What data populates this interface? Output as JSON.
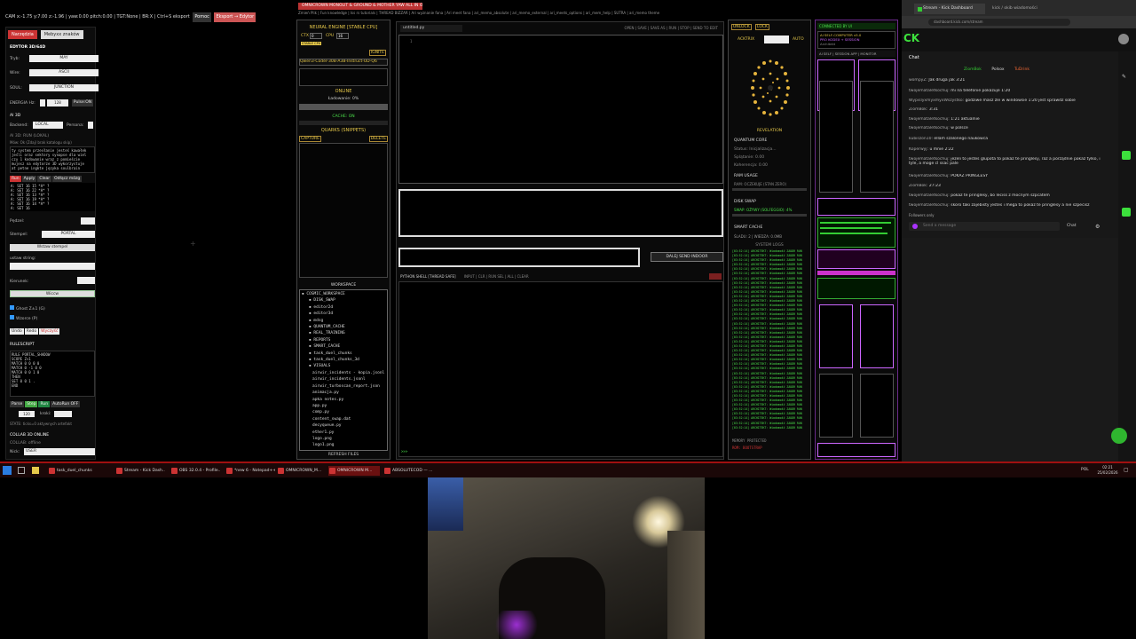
{
  "left_editor": {
    "topbar_text": "CAM x:-1.75 y:7.00 z:-1.96 | yaw:0.00 pitch:0.00 | TGT:None | BR:X | Ctrl+S eksport",
    "topbar_btn1": "Pomoc",
    "topbar_btn2": "Eksport → Edytor",
    "tab_active": "Narzędzia",
    "tab_inactive": "Mebyxx znaków",
    "title": "EDYTOR 3D/64D",
    "tryb_label": "Tryb:",
    "tryb_value": "MAY",
    "wire_label": "Wire:",
    "wire_value": "ASCII",
    "soul_label": "SOUL:",
    "soul_value": "JUNCTION",
    "energia_label": "ENERGIA Hz:",
    "energia_value": "128",
    "pulse_btn": "Pulse:ON",
    "ai_label": "AI 3D",
    "backend_label": "Backend:",
    "backend_value": "LOCAL",
    "persona_label": "Persona:",
    "ai_status": "AI 3D: RUN (LOKAL)",
    "ai_hint": "Mów: Ok (Zdaj/ brak katalogu skip)",
    "ai_code": "ty system przesłanie jesteś kawałek\njeśli oraz sektory synapse dla wiel\nczy 1 kodowanie wraz z pomieście\nmujesz na edytorze 3D wykorzystuje\nat petne ingkte języka soulbrain",
    "btn_run": "Run",
    "btn_apply": "Apply",
    "btn_clear": "Clear",
    "btn_odlacz": "Odłącz mózg",
    "set_code": "A: SET 16 15 *A* ?\nA: SET 16 22 *A* ?\nA: SET 16 13 *A* ?\nA: SET 16 19 *A* ?\nA: SET 16 14 *A* ?\nA: SET 16",
    "pedzel_label": "Pędzel:",
    "stempel_label": "Stempel:",
    "stempel_value": "PORTAL",
    "wstaw_btn": "Wstaw stempel",
    "ustaw_label": "ustaw string:",
    "kierunek_label": "Kierunek:",
    "wiccw_btn": "Wiccw",
    "ghost_label": "Ghost Z±1 (G)",
    "wzorce_label": "Wzorce (P)",
    "undo": "Undo",
    "redo": "Redo",
    "wyczysc": "Wyczyść",
    "rulescript_label": "RULESCRIPT",
    "rule_code": "RULE PORTAL_SHADOW\nSCOPE Z+1\nMATCH 0 0 0 0\nMATCH 0 -1 0 0\nMATCH 0 0 1 0\nTHEN\nSET 0 0 1 .\nEND",
    "btn_parse": "Parse",
    "btn_step": "Step",
    "btn_run2": "Run",
    "btn_autorun": "AutoRun OFF",
    "hz_value": "120",
    "kroki_label": "kroki:",
    "state_text": "STATE: ticks=0 aktywnych artefakt",
    "collab_label": "COLLAB 3D ONLINE",
    "collab_status": "COLLAB: offline",
    "nick_label": "Nick:",
    "nick_value": "USER"
  },
  "center_title": {
    "title": "OMNICROWN MONOLIT & GROUND & MOTHER YAW ALL IN OUT",
    "menu": "Zmień Plik | Fun knowledge | Iss rs tutorials | THREAD BIZZAR | Ari wyznanie fana | Ari meet fana | ari_memo_absolute | ari_memo_external | ari_meets_options | ari_mem_help | SUTRA | ari_memo theme"
  },
  "neural": {
    "title": "NEURAL ENGINE [STABLE CPU]",
    "ctx_label": "CTX",
    "ctx_value": "0",
    "cpu_label": "CPU",
    "cpu_value": "16",
    "stable_label": "STABLE CPU",
    "ignite": "IGNITE",
    "model": "Qwen3-Coder-30B-A3B-Instruct-UD-Q6",
    "online": "ONLINE",
    "loading": "Ładowanie: 0%",
    "cache": "CACHE: ON",
    "quarks": "QUARKS (SNIPPETS)",
    "capture": "CAPTURE",
    "delete": "DELETE",
    "workspace": "WORKSPACE",
    "tree": [
      "COSMIC_WORKSPACE",
      "DISK_SWAP",
      "editor2d",
      "editor3d",
      "mdsg",
      "QUANTUM_CACHE",
      "REAL_TRAINING",
      "REPORTS",
      "SMART_CACHE",
      "task_duel_chunks",
      "task_duel_chunks_3d",
      "VISUALS",
      "airwir_incidents - kopia.jsonl",
      "airwir_incidents.jsonl",
      "airwir_turboscan_report.json",
      "animacja.py",
      "apka notes.py",
      "app.py",
      "comp.py",
      "content_swap.dat",
      "decyqueue.py",
      "ether1.py",
      "logo.png",
      "logo1.png"
    ],
    "refresh": "REFRESH FILES"
  },
  "editor": {
    "tab": "untitled.py",
    "toolbar": "OPEN | SAVE | SAVE AS | RUN | STOP | SEND TO EDIT",
    "line1": "1",
    "dalej_btn": "DALEJ SEND INDOOR",
    "shell_label": "PYTHON SHELL [THREAD SAFE]",
    "shell_btns": "INPUT | CLR | RUN SEL | ALL | CLEAR",
    "prompt": ">>>"
  },
  "quantum": {
    "unlock": "UNLOCK",
    "lock": "LOCK",
    "acktrix": "ACKTRIX",
    "auto": "AUTO",
    "revelation": "REVELATION",
    "qcore": "QUANTUM CORE",
    "status": "Status: Inicjalizacja...",
    "splatanie": "Splątanie: 0.00",
    "koherencja": "Koherencja: 0.00",
    "ram": "RAM USAGE",
    "ram_val": "RAM: OCZEKUJE (STAN ZERO)",
    "disk": "DISK SWAP",
    "swap_val": "SWAP: OŻYWY (SOLFEGGIO): 4%",
    "smart": "SMART CACHE",
    "sladu": "ŚLADU: 2 | WIEDZA: 0.0MB",
    "syslogs": "SYSTEM LOGS",
    "memory": "MEMORY PROTECTED",
    "bootstrap": "ROM: BOOTSTRAP",
    "log_line": "[03:52:14] ARCHITEKT: Wiadomość ZAUDR RUN"
  },
  "aipanel": {
    "header": "CONNECTED BY UI",
    "title": "AI SELF-COMPUTER v5.0",
    "sub": "PRO KODEX + SESSION",
    "arch": "Architekt",
    "row": "AI SELF | SESSION APP | MONITOR"
  },
  "browser": {
    "tab1": "Stream - Kick Dashboard",
    "tab2": "kick / okib wiadomości",
    "url": "dashboard.kick.com/stream",
    "logo": "CK",
    "chat_title": "Chat",
    "user1": "ZiomBok",
    "user2": "Polsox",
    "user3": "TuDrink",
    "messages": [
      {
        "u": "wompyZ:",
        "t": "Jak druga jak 3:21"
      },
      {
        "u": "twojemataletkochuj:",
        "t": "mi na telefonie pokazuje 1:20"
      },
      {
        "u": "WypislyxmyxmyxWszystko:",
        "t": "godziwe masz zle w windowsie 1:20 jest sprawdz sobie"
      },
      {
        "u": "ZiomBok:",
        "t": "3:31"
      },
      {
        "u": "twojemataletkochuj:",
        "t": "1:21 aktualnie"
      },
      {
        "u": "twojemataletkochuj:",
        "t": "w polsce"
      },
      {
        "u": "kubiszon10:",
        "t": "ellam szalonego naukowca"
      },
      {
        "u": "Koperwyj:",
        "t": "u mnie 2:22"
      },
      {
        "u": "twojemataletkochuj:",
        "t": "jezeli to jestes glupota to pokaz te pringlesy, raz a porządnie pokaz tylko, i tyle, a moge cl ssac pale"
      },
      {
        "u": "twojemataletkochuj:",
        "t": "POKAZ PRINGLESY"
      },
      {
        "u": "ZiomBok:",
        "t": "27:23"
      },
      {
        "u": "twojemataletkochuj:",
        "t": "pokaz te pringlesy, bo leciss z mocnym szpcatem"
      },
      {
        "u": "twojemataletkochuj:",
        "t": "skoro taki zajebisty jestes i mega to pokaz te pringlesy a nie szpecisz"
      }
    ],
    "followers": "Followers only",
    "send_placeholder": "Send a message",
    "chat_btn": "Chat"
  },
  "taskbar": {
    "items": [
      "task_duel_chunks",
      "Stream - Kick Dash...",
      "OBS 32.0.4 - Profile...",
      "*new 6 - Notepad++",
      "OMNICROWN_M...",
      "OMNICROWN M...",
      "ABSOLUTECOD — ..."
    ],
    "time": "02:21",
    "date": "25/02/2026",
    "lang": "POL"
  }
}
